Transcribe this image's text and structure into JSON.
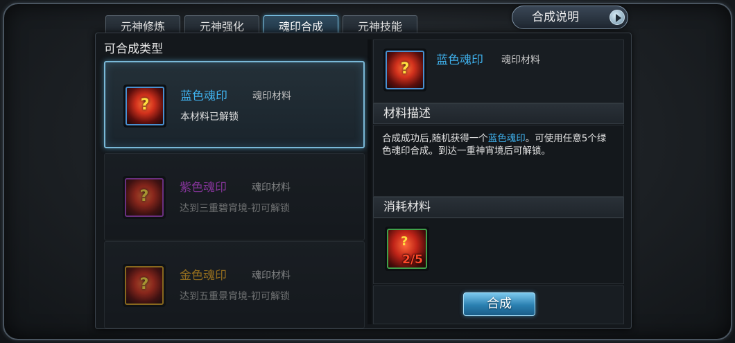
{
  "tabs": [
    {
      "label": "元神修炼",
      "active": false
    },
    {
      "label": "元神强化",
      "active": false
    },
    {
      "label": "魂印合成",
      "active": true
    },
    {
      "label": "元神技能",
      "active": false
    }
  ],
  "help_button": {
    "label": "合成说明"
  },
  "left_panel": {
    "title": "可合成类型",
    "items": [
      {
        "name": "蓝色魂印",
        "type": "魂印材料",
        "status": "本材料已解锁",
        "name_color": "#3fb2ee",
        "border_color": "#4a90d0"
      },
      {
        "name": "紫色魂印",
        "type": "魂印材料",
        "status": "达到三重碧宵境-初可解锁",
        "name_color": "#c445e0",
        "border_color": "#a040c0"
      },
      {
        "name": "金色魂印",
        "type": "魂印材料",
        "status": "达到五重景宵境-初可解锁",
        "name_color": "#e0a020",
        "border_color": "#d09a20"
      }
    ]
  },
  "detail": {
    "name": "蓝色魂印",
    "type": "魂印材料",
    "desc_header": "材料描述",
    "desc_part1": "合成成功后,随机获得一个",
    "desc_highlight": "蓝色魂印",
    "desc_part2": "。可使用任意5个绿色魂印合成。到达一重神宵境后可解锁。",
    "materials_header": "消耗材料",
    "material_count": "2/5",
    "combine_label": "合成"
  },
  "colors": {
    "accent": "#3fb2ee",
    "material_border": "#3fa04a",
    "count_red": "#ff4a2a"
  }
}
